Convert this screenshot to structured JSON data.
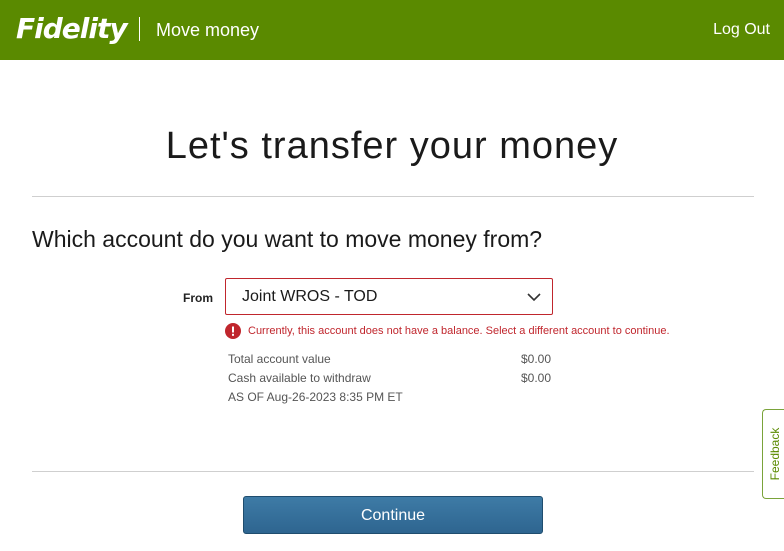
{
  "header": {
    "logo_text": "Fidelity",
    "app_title": "Move money",
    "logout_label": "Log Out",
    "bg_color": "#5a8a00"
  },
  "main": {
    "title": "Let's transfer your money",
    "question": "Which account do you want to move money from?",
    "from_label": "From",
    "selected_account": "Joint WROS - TOD",
    "error_message": "Currently, this account does not have a balance. Select a different account to continue.",
    "error_color": "#c0262d",
    "account_info": [
      {
        "label": "Total account value",
        "value": "$0.00"
      },
      {
        "label": "Cash available to withdraw",
        "value": "$0.00"
      }
    ],
    "as_of": "AS OF Aug-26-2023 8:35 PM ET",
    "continue_label": "Continue"
  },
  "feedback": {
    "label": "Feedback"
  },
  "icons": {
    "dropdown": "chevron-down-icon",
    "error": "error-icon"
  }
}
